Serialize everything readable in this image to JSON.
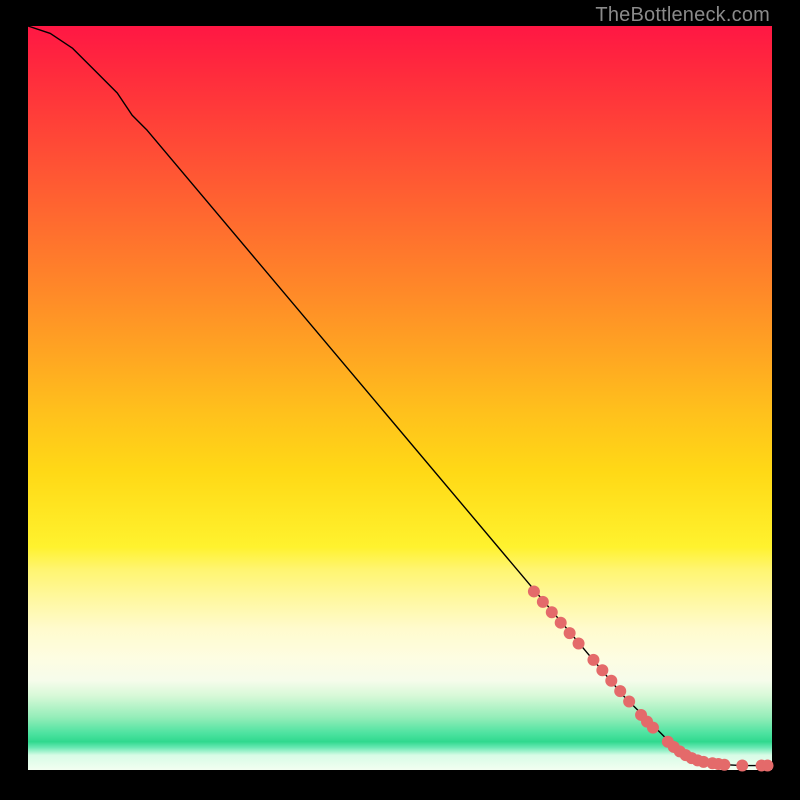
{
  "attribution": "TheBottleneck.com",
  "chart_data": {
    "type": "line",
    "title": "",
    "xlabel": "",
    "ylabel": "",
    "xlim": [
      0,
      100
    ],
    "ylim": [
      0,
      100
    ],
    "grid": false,
    "series": [
      {
        "name": "curve",
        "color": "#000000",
        "stroke_width": 1.4,
        "x": [
          0,
          3,
          6,
          9,
          12,
          14,
          16,
          80,
          85,
          88,
          92,
          96,
          100
        ],
        "y": [
          100,
          99,
          97,
          94,
          91,
          88,
          86,
          10,
          5,
          2,
          0.8,
          0.6,
          0.6
        ]
      }
    ],
    "points": [
      {
        "name": "highlight",
        "color": "#e46a6a",
        "radius": 6,
        "x": [
          68.0,
          69.2,
          70.4,
          71.6,
          72.8,
          74.0,
          76.0,
          77.2,
          78.4,
          79.6,
          80.8,
          82.4,
          83.2,
          84.0,
          86.0,
          86.8,
          87.6,
          88.4,
          89.2,
          90.0,
          90.8,
          92.0,
          92.8,
          93.6,
          96.0,
          98.6,
          99.4
        ],
        "y": [
          24.0,
          22.6,
          21.2,
          19.8,
          18.4,
          17.0,
          14.8,
          13.4,
          12.0,
          10.6,
          9.2,
          7.4,
          6.5,
          5.7,
          3.8,
          3.1,
          2.5,
          2.0,
          1.6,
          1.3,
          1.1,
          0.9,
          0.8,
          0.7,
          0.6,
          0.6,
          0.6
        ]
      }
    ]
  }
}
